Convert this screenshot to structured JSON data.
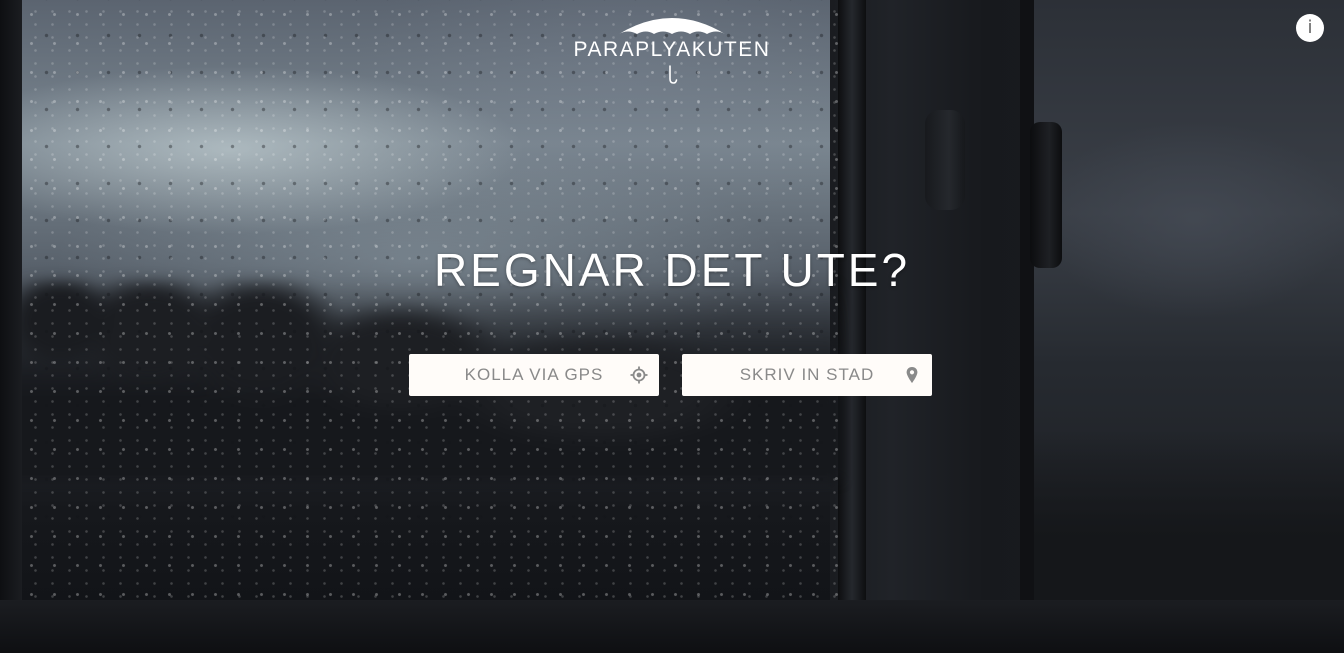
{
  "header": {
    "logo_text": "PARAPLYAKUTEN",
    "info_label": "i"
  },
  "main": {
    "headline": "REGNAR DET UTE?",
    "gps_button": {
      "label": "KOLLA VIA GPS",
      "icon": "crosshair-location-icon"
    },
    "city_button": {
      "label": "SKRIV IN STAD",
      "icon": "map-pin-icon"
    }
  },
  "colors": {
    "button_bg": "#fffcf9",
    "button_text": "#8a8a8a",
    "text_light": "#ffffff"
  }
}
